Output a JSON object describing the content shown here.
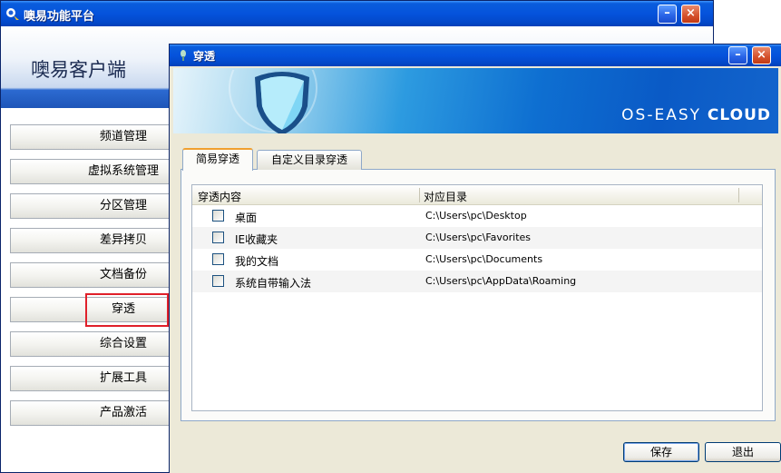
{
  "main_window": {
    "title": "噢易功能平台",
    "app_name": "噢易客户端",
    "minimize": "–",
    "close": "×"
  },
  "sidebar": {
    "items": [
      {
        "label": "频道管理"
      },
      {
        "label": "虚拟系统管理"
      },
      {
        "label": "分区管理"
      },
      {
        "label": "差异拷贝"
      },
      {
        "label": "文档备份"
      },
      {
        "label": "穿透"
      },
      {
        "label": "综合设置"
      },
      {
        "label": "扩展工具"
      },
      {
        "label": "产品激活"
      }
    ],
    "selected": "穿透"
  },
  "dialog": {
    "title": "穿透",
    "minimize": "–",
    "close": "×",
    "brand_left": "OS-EASY",
    "brand_right": "CLOUD",
    "tabs": [
      {
        "label": "简易穿透",
        "active": true
      },
      {
        "label": "自定义目录穿透",
        "active": false
      }
    ],
    "columns": [
      "穿透内容",
      "对应目录"
    ],
    "rows": [
      {
        "name": "桌面",
        "path": "C:\\Users\\pc\\Desktop",
        "checked": false
      },
      {
        "name": "IE收藏夹",
        "path": "C:\\Users\\pc\\Favorites",
        "checked": false
      },
      {
        "name": "我的文档",
        "path": "C:\\Users\\pc\\Documents",
        "checked": false
      },
      {
        "name": "系统自带输入法",
        "path": "C:\\Users\\pc\\AppData\\Roaming",
        "checked": false
      }
    ],
    "save_label": "保存",
    "exit_label": "退出"
  },
  "colors": {
    "titlebar": "#0553dc",
    "highlight": "#e0202a",
    "dialog_bg": "#ece9d8"
  }
}
